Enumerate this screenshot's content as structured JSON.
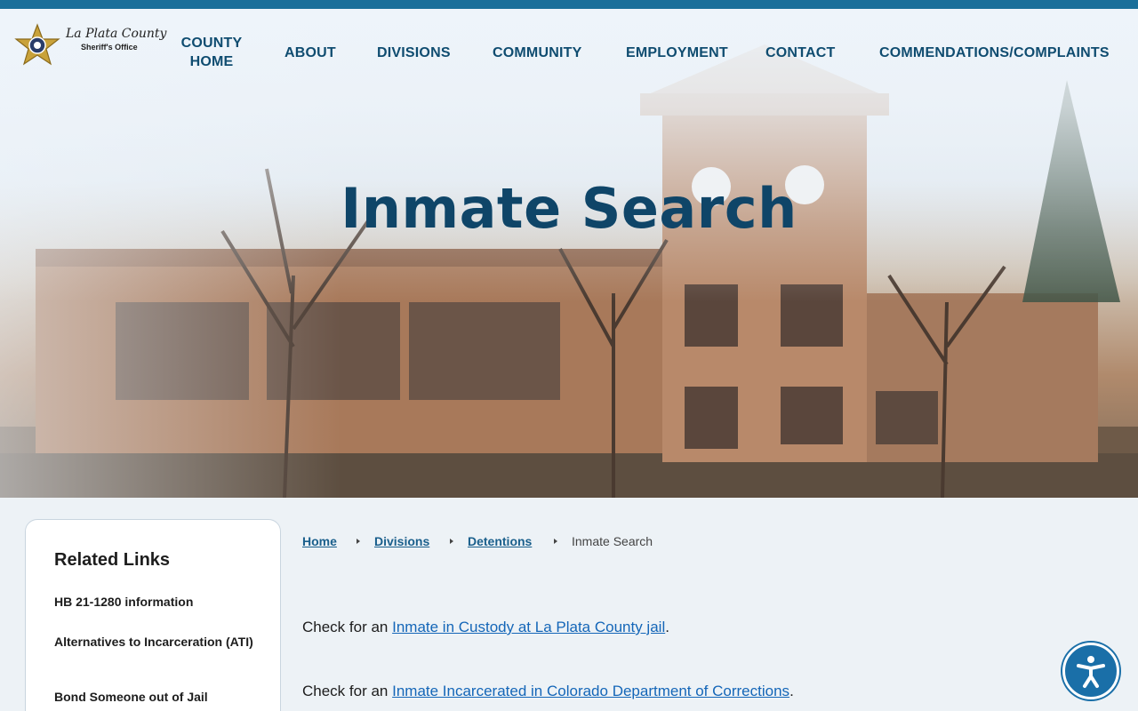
{
  "header": {
    "logo": {
      "line1": "La Plata County",
      "line2": "Sheriff's Office"
    },
    "nav": [
      {
        "label": "COUNTY HOME"
      },
      {
        "label": "ABOUT"
      },
      {
        "label": "DIVISIONS"
      },
      {
        "label": "COMMUNITY"
      },
      {
        "label": "EMPLOYMENT"
      },
      {
        "label": "CONTACT"
      },
      {
        "label": "COMMENDATIONS/COMPLAINTS"
      }
    ]
  },
  "hero": {
    "title": "Inmate Search"
  },
  "sidebar": {
    "heading": "Related Links",
    "links": [
      {
        "label": "HB 21-1280 information"
      },
      {
        "label": "Alternatives to Incarceration (ATI)"
      },
      {
        "label": "Bond Someone out of Jail"
      }
    ]
  },
  "breadcrumb": {
    "items": [
      {
        "label": "Home"
      },
      {
        "label": "Divisions"
      },
      {
        "label": "Detentions"
      }
    ],
    "current": "Inmate Search"
  },
  "content": {
    "p1": {
      "prefix": "Check for an ",
      "link": "Inmate in Custody at La Plata County jail",
      "suffix": "."
    },
    "p2": {
      "prefix": "Check for an ",
      "link": "Inmate Incarcerated in Colorado Department of Corrections",
      "suffix": "."
    }
  },
  "colors": {
    "brand": "#0f4c70",
    "accent": "#1a6f9a",
    "link": "#1466b8"
  },
  "icons": {
    "accessibility": "accessibility-icon",
    "badge": "sheriff-star-icon"
  }
}
